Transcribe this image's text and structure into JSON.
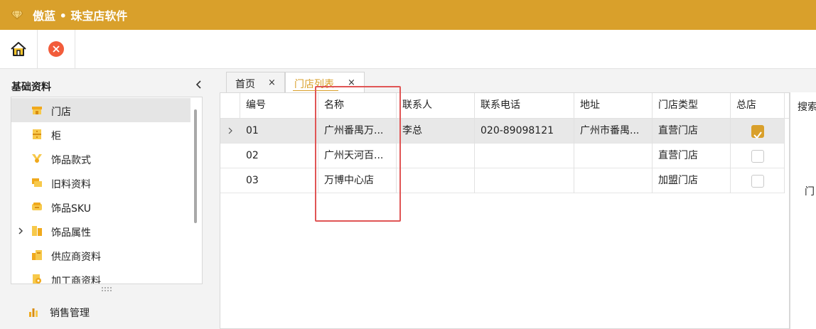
{
  "app": {
    "title": "傲蓝 • 珠宝店软件",
    "accent_color": "#d9a02b"
  },
  "toolbar": {
    "home_icon": "home-icon",
    "close_icon": "close-circle-icon"
  },
  "sidebar": {
    "heading": "基础资料",
    "items": [
      {
        "label": "门店",
        "icon": "store-icon",
        "active": true
      },
      {
        "label": "柜",
        "icon": "cabinet-icon"
      },
      {
        "label": "饰品款式",
        "icon": "jewelry-style-icon"
      },
      {
        "label": "旧料资料",
        "icon": "old-material-icon"
      },
      {
        "label": "饰品SKU",
        "icon": "sku-icon"
      },
      {
        "label": "饰品属性",
        "icon": "attribute-icon",
        "expandable": true
      },
      {
        "label": "供应商资料",
        "icon": "supplier-icon"
      },
      {
        "label": "加工商资料",
        "icon": "processor-icon"
      }
    ],
    "section2": {
      "label": "销售管理",
      "icon": "bar-chart-icon"
    }
  },
  "tabs": [
    {
      "label": "首页",
      "close": "×"
    },
    {
      "label": "门店列表",
      "close": "×",
      "active": true
    }
  ],
  "table": {
    "columns": [
      "编号",
      "名称",
      "联系人",
      "联系电话",
      "地址",
      "门店类型",
      "总店"
    ],
    "rows": [
      {
        "id": "01",
        "name": "广州番禺万...",
        "contact": "李总",
        "phone": "020-89098121",
        "address": "广州市番禺...",
        "type": "直营门店",
        "head": true
      },
      {
        "id": "02",
        "name": "广州天河百...",
        "contact": "",
        "phone": "",
        "address": "",
        "type": "直营门店",
        "head": false
      },
      {
        "id": "03",
        "name": "万博中心店",
        "contact": "",
        "phone": "",
        "address": "",
        "type": "加盟门店",
        "head": false
      }
    ]
  },
  "right_panel": {
    "search_label": "搜索",
    "fragment": "门"
  }
}
